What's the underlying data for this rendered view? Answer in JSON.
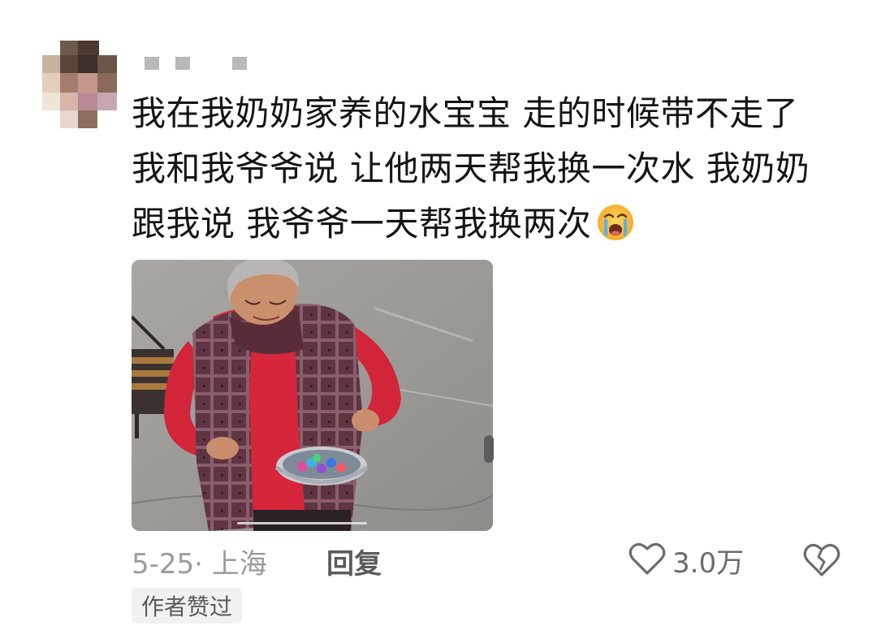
{
  "comment": {
    "text_lines": [
      "我在我奶奶家养的水宝宝 走的时候带不走了",
      "我和我爷爷说 让他两天帮我换一次水 我奶奶",
      "跟我说 我爷爷一天帮我换两次"
    ],
    "trailing_emoji": "loudly-crying-face",
    "date_location": "5-25· 上海",
    "reply_label": "回复",
    "like_count": "3.0万",
    "author_liked_badge": "作者赞过"
  },
  "colors": {
    "text_primary": "#151515",
    "text_secondary": "#9b9b9b",
    "reply": "#5b5b5b",
    "badge_bg": "#f1f1f1",
    "icon_stroke": "#6b6b6b"
  },
  "icons": {
    "avatar": "avatar-mosaic",
    "like": "heart-outline-icon",
    "dislike": "broken-heart-icon"
  }
}
